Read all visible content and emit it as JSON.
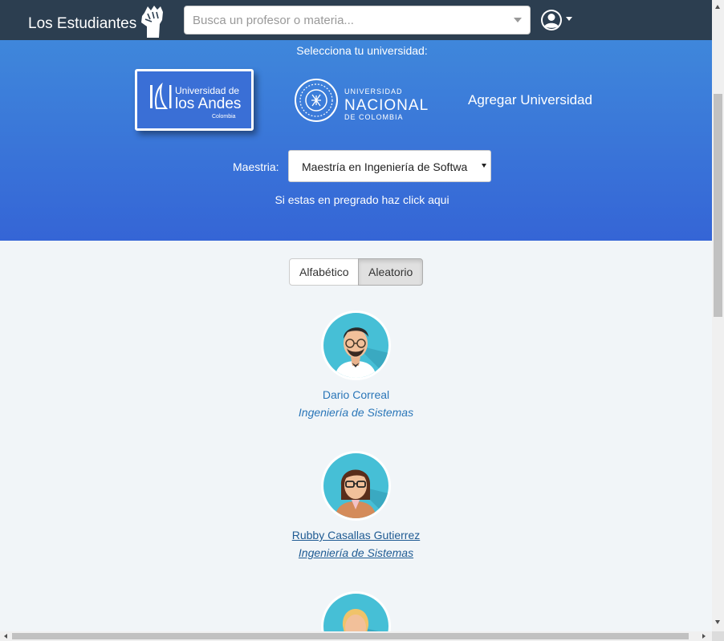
{
  "navbar": {
    "brand": "Los Estudiantes",
    "search_placeholder": "Busca un profesor o materia...",
    "logo_icon": "fist-icon",
    "user_icon": "user-circle-icon"
  },
  "hero": {
    "title": "Selecciona tu universidad:",
    "universities": [
      {
        "name_line1": "Universidad de",
        "name_line2": "los Andes",
        "name_line3": "Colombia"
      },
      {
        "name_line1": "UNIVERSIDAD",
        "name_line2": "NACIONAL",
        "name_line3": "DE COLOMBIA"
      }
    ],
    "add_university": "Agregar Universidad",
    "maestria_label": "Maestria:",
    "maestria_value": "Maestría en Ingeniería de Softwa",
    "pregrado_link": "Si estas en pregrado haz click aqui"
  },
  "sort": {
    "options": [
      "Alfabético",
      "Aleatorio"
    ],
    "active": "Aleatorio"
  },
  "professors": [
    {
      "name": "Dario Correal",
      "major": "Ingeniería de Sistemas"
    },
    {
      "name": "Rubby Casallas Gutierrez",
      "major": "Ingeniería de Sistemas"
    }
  ],
  "colors": {
    "navbar": "#2c3e50",
    "hero_top": "#3f87db",
    "hero_bottom": "#3565d6",
    "link": "#2a76b8",
    "avatar_bg": "#46bfd6"
  }
}
